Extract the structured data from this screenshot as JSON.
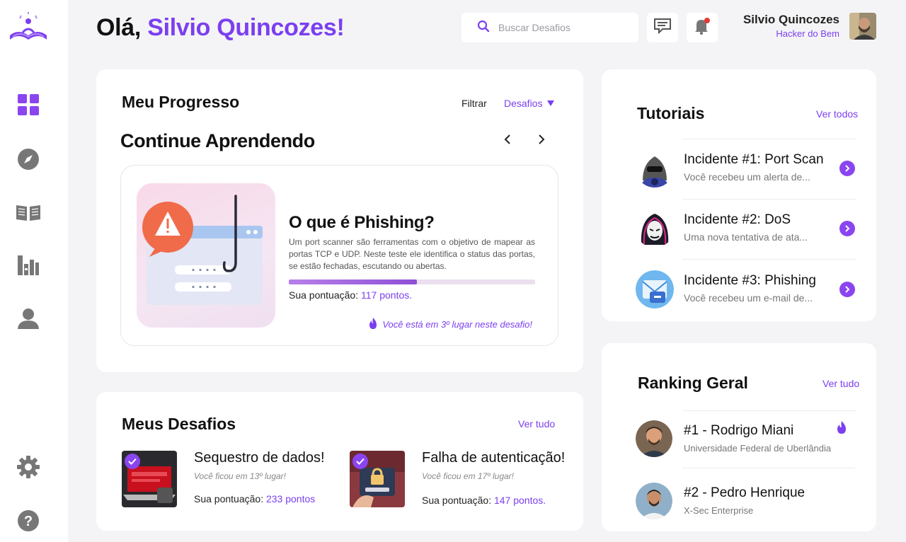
{
  "greeting": {
    "prefix": "Olá,",
    "name": "Silvio Quincozes!"
  },
  "search": {
    "placeholder": "Buscar Desafios"
  },
  "user": {
    "name": "Silvio Quincozes",
    "role": "Hacker do Bem"
  },
  "colors": {
    "accent": "#7b3ff0",
    "badge": "#e53935"
  },
  "sidebar": {
    "items": [
      {
        "icon": "dashboard-icon"
      },
      {
        "icon": "compass-icon"
      },
      {
        "icon": "book-icon"
      },
      {
        "icon": "library-icon"
      },
      {
        "icon": "user-icon"
      },
      {
        "icon": "gear-icon"
      },
      {
        "icon": "help-icon"
      }
    ]
  },
  "progress": {
    "title": "Meu Progresso",
    "filter_label": "Filtrar",
    "filter_value": "Desafios",
    "subtitle": "Continue Aprendendo",
    "lesson": {
      "title": "O que é Phishing?",
      "description": "Um port scanner são ferramentas com o objetivo de mapear as portas TCP e UDP.  Neste teste ele identifica o status das portas, se estão fechadas, escutando ou abertas.",
      "progress": 0.52,
      "score_label": "Sua pontuação:",
      "score_value": "117 pontos.",
      "rank_text": "Você está em 3º lugar neste desafio!"
    }
  },
  "tutorials": {
    "title": "Tutoriais",
    "link": "Ver todos",
    "items": [
      {
        "title": "Incidente #1: Port Scan",
        "subtitle": "Você recebeu um alerta de..."
      },
      {
        "title": "Incidente #2: DoS",
        "subtitle": "Uma nova tentativa de ata..."
      },
      {
        "title": "Incidente #3: Phishing",
        "subtitle": "Você recebeu um e-mail de..."
      }
    ]
  },
  "challenges": {
    "title": "Meus Desafios",
    "link": "Ver tudo",
    "items": [
      {
        "title": "Sequestro de dados!",
        "subtitle": "Você ficou em 13º lugar!",
        "score_label": "Sua pontuação:",
        "score_value": "233 pontos"
      },
      {
        "title": "Falha de autenticação!",
        "subtitle": "Você ficou em 17º lugar!",
        "score_label": "Sua pontuação:",
        "score_value": "147 pontos."
      }
    ]
  },
  "ranking": {
    "title": "Ranking Geral",
    "link": "Ver tudo",
    "items": [
      {
        "name": "#1 - Rodrigo Miani",
        "subtitle": "Universidade Federal de Uberlândia"
      },
      {
        "name": "#2 - Pedro Henrique",
        "subtitle": "X-Sec Enterprise"
      }
    ]
  }
}
